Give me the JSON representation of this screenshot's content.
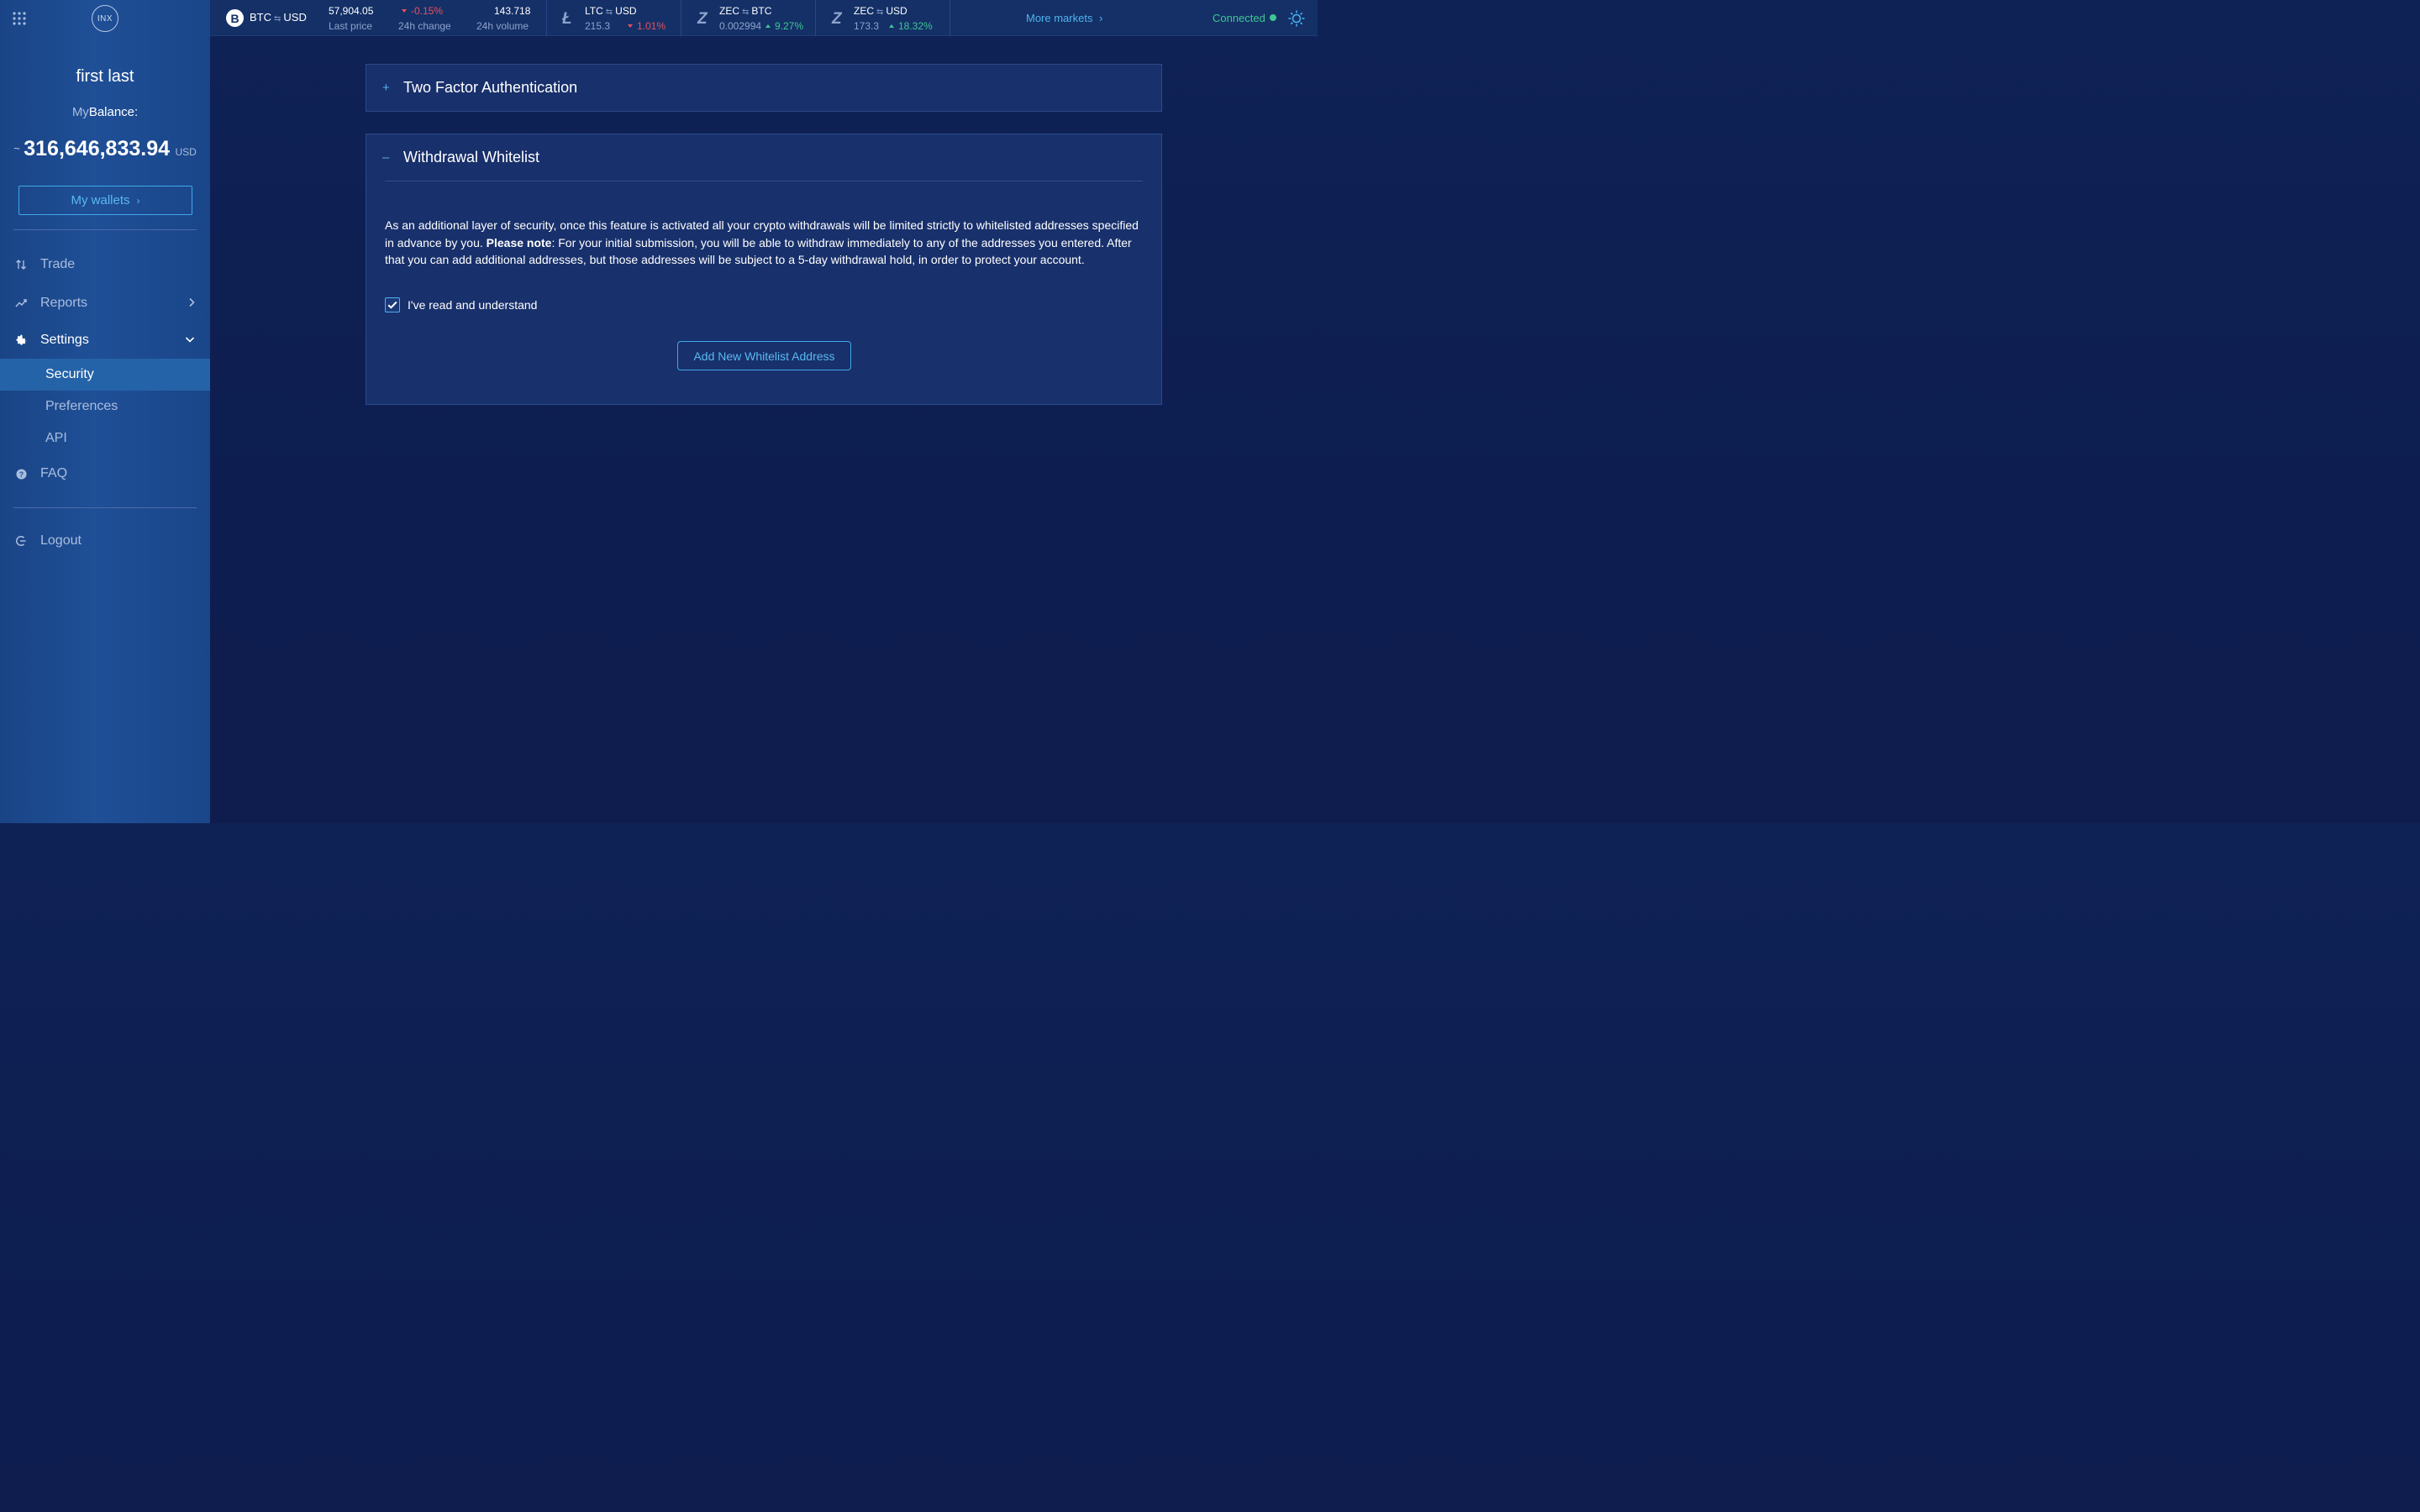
{
  "sidebar": {
    "logo_text": "INX",
    "user_name": "first last",
    "balance_label_prefix": "My",
    "balance_label_main": "Balance:",
    "balance_tilde": "~",
    "balance_amount": "316,646,833.94",
    "balance_currency": "USD",
    "wallets_label": "My wallets",
    "nav": {
      "trade": "Trade",
      "reports": "Reports",
      "settings": "Settings",
      "faq": "FAQ",
      "logout": "Logout"
    },
    "settings_sub": {
      "security": "Security",
      "preferences": "Preferences",
      "api": "API"
    },
    "active_item": "Security"
  },
  "topbar": {
    "main": {
      "coin_symbol": "B",
      "base": "BTC",
      "quote": "USD",
      "swap": "⇆",
      "last_price": "57,904.05",
      "last_price_label": "Last price",
      "change": "-0.15%",
      "change_label": "24h change",
      "volume": "143.718",
      "volume_label": "24h volume"
    },
    "tickers": [
      {
        "base": "LTC",
        "quote": "USD",
        "price": "215.3",
        "change": "1.01%",
        "direction": "down"
      },
      {
        "base": "ZEC",
        "quote": "BTC",
        "price": "0.002994",
        "change": "9.27%",
        "direction": "up"
      },
      {
        "base": "ZEC",
        "quote": "USD",
        "price": "173.3",
        "change": "18.32%",
        "direction": "up"
      }
    ],
    "more_markets": "More markets",
    "status": "Connected"
  },
  "main": {
    "two_factor": {
      "toggle": "+",
      "title": "Two Factor Authentication"
    },
    "whitelist": {
      "toggle": "–",
      "title": "Withdrawal Whitelist",
      "desc_1": "As an additional layer of security, once this feature is activated all your crypto withdrawals will be limited strictly to whitelisted addresses specified in advance by you. ",
      "desc_note": "Please note",
      "desc_2": ": For your initial submission, you will be able to withdraw immediately to any of the addresses you entered. After that you can add additional addresses, but those addresses will be subject to a 5-day withdrawal hold, in order to protect your account.",
      "checkbox_label": "I've read and understand",
      "checkbox_checked": true,
      "add_button": "Add New Whitelist Address"
    }
  },
  "colors": {
    "accent": "#4fb2ee",
    "positive": "#3ec790",
    "negative": "#e8505b",
    "background": "#0f2256",
    "sidebar": "#1f4f96"
  }
}
